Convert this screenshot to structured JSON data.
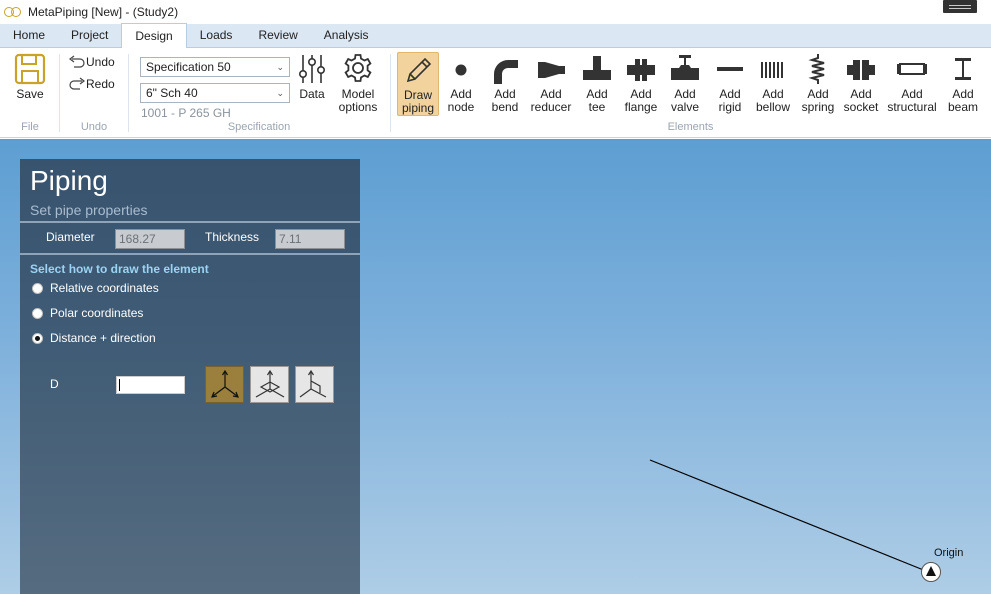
{
  "window": {
    "title": "MetaPiping [New] - (Study2)"
  },
  "tabs": [
    "Home",
    "Project",
    "Design",
    "Loads",
    "Review",
    "Analysis"
  ],
  "ribbon": {
    "file": {
      "save_label": "Save",
      "group_label": "File"
    },
    "undo": {
      "undo_label": "Undo",
      "redo_label": "Redo",
      "group_label": "Undo"
    },
    "specification": {
      "spec_value": "Specification 50",
      "size_value": "6\" Sch 40",
      "material": "1001 - P 265 GH",
      "data_label": "Data",
      "model_options_label_1": "Model",
      "model_options_label_2": "options",
      "group_label": "Specification"
    },
    "elements": {
      "group_label": "Elements",
      "buttons": [
        {
          "l1": "Draw",
          "l2": "piping",
          "icon": "pencil-icon"
        },
        {
          "l1": "Add",
          "l2": "node",
          "icon": "node-icon"
        },
        {
          "l1": "Add",
          "l2": "bend",
          "icon": "bend-icon"
        },
        {
          "l1": "Add",
          "l2": "reducer",
          "icon": "reducer-icon"
        },
        {
          "l1": "Add",
          "l2": "tee",
          "icon": "tee-icon"
        },
        {
          "l1": "Add",
          "l2": "flange",
          "icon": "flange-icon"
        },
        {
          "l1": "Add",
          "l2": "valve",
          "icon": "valve-icon"
        },
        {
          "l1": "Add",
          "l2": "rigid",
          "icon": "rigid-icon"
        },
        {
          "l1": "Add",
          "l2": "bellow",
          "icon": "bellow-icon"
        },
        {
          "l1": "Add",
          "l2": "spring",
          "icon": "spring-icon"
        },
        {
          "l1": "Add",
          "l2": "socket",
          "icon": "socket-icon"
        },
        {
          "l1": "Add",
          "l2": "structural",
          "icon": "structural-icon"
        },
        {
          "l1": "Add",
          "l2": "beam",
          "icon": "beam-icon"
        }
      ]
    }
  },
  "panel": {
    "title": "Piping",
    "subtitle": "Set pipe properties",
    "diameter_label": "Diameter",
    "diameter_value": "168.27",
    "thickness_label": "Thickness",
    "thickness_value": "7.11",
    "section_heading": "Select how to draw the element",
    "options": [
      {
        "label": "Relative coordinates",
        "checked": false
      },
      {
        "label": "Polar coordinates",
        "checked": false
      },
      {
        "label": "Distance + direction",
        "checked": true
      }
    ],
    "d_label": "D",
    "d_value": ""
  },
  "viewport": {
    "origin_label": "Origin"
  },
  "colors": {
    "accent": "#f2d39e",
    "panel": "#3f5b75",
    "heading": "#9cd3f4",
    "viewport_top": "#5d9ed2"
  }
}
